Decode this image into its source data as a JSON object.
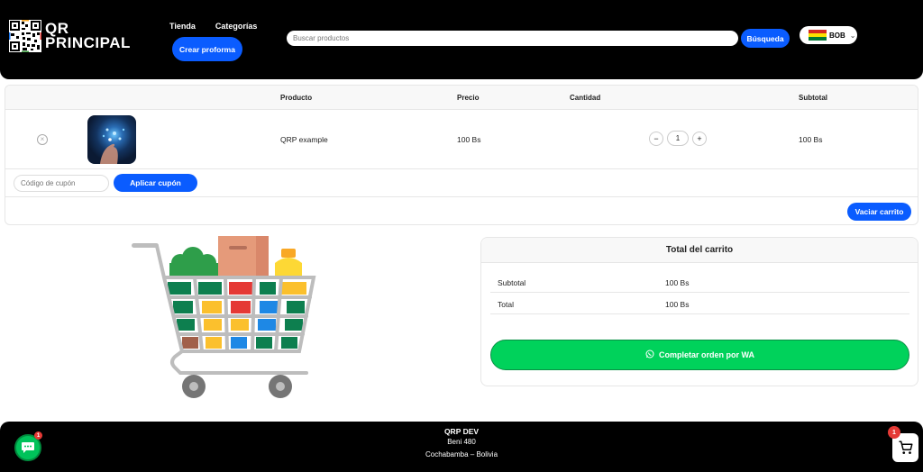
{
  "header": {
    "logo_line1": "QR",
    "logo_line2": "PRINCIPAL",
    "nav": [
      "Tienda",
      "Categorías"
    ],
    "proforma_button": "Crear proforma",
    "search_placeholder": "Buscar productos",
    "search_button": "Búsqueda",
    "currency": "BOB"
  },
  "cart": {
    "columns": {
      "product": "Producto",
      "price": "Precio",
      "quantity": "Cantidad",
      "subtotal": "Subtotal"
    },
    "items": [
      {
        "name": "QRP example",
        "price": "100 Bs",
        "quantity": "1",
        "subtotal": "100 Bs"
      }
    ],
    "coupon_placeholder": "Código de cupón",
    "apply_coupon": "Aplicar cupón",
    "empty_cart": "Vaciar carrito"
  },
  "totals": {
    "title": "Total del carrito",
    "subtotal_label": "Subtotal",
    "subtotal_value": "100 Bs",
    "total_label": "Total",
    "total_value": "100 Bs",
    "checkout_button": "Completar orden por WA"
  },
  "footer": {
    "name": "QRP DEV",
    "address": "Beni 480",
    "city": "Cochabamba – Bolivia"
  },
  "floating": {
    "chat_badge": "1",
    "cart_badge": "1"
  },
  "colors": {
    "primary_blue": "#0a5cff",
    "whatsapp_green": "#00d25b",
    "header_bg": "#000000"
  },
  "icons": [
    "qr-logo-icon",
    "flag-bolivia-icon",
    "chevron-down-icon",
    "remove-icon",
    "whatsapp-icon",
    "chat-icon",
    "cart-icon",
    "shopping-cart-illustration"
  ]
}
